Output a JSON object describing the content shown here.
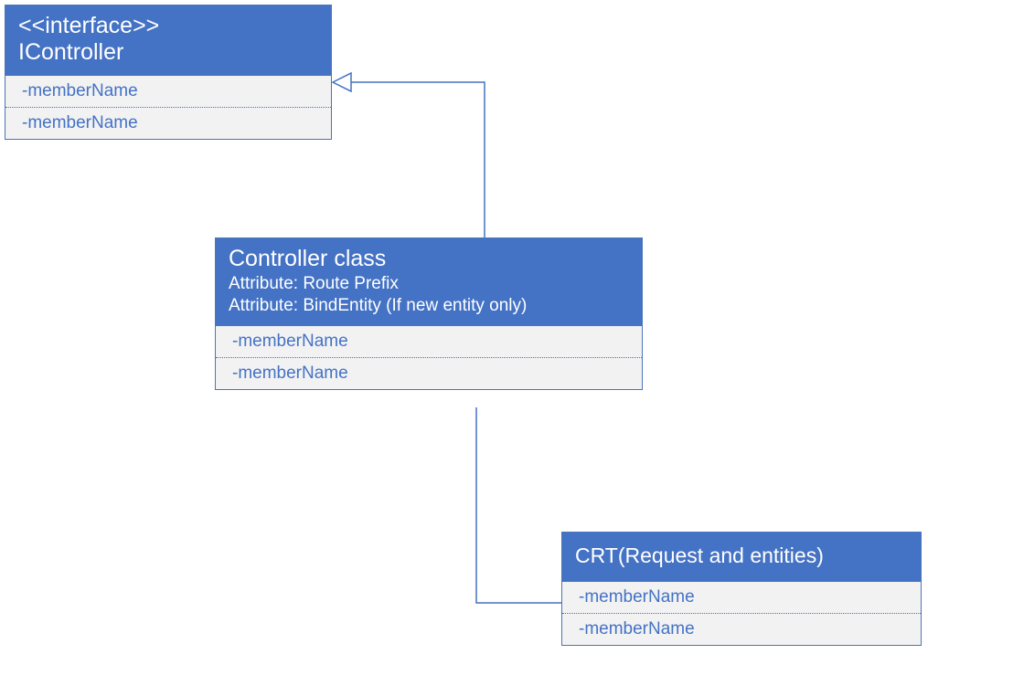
{
  "diagram": {
    "interface": {
      "stereotype": "<<interface>>",
      "name": "IController",
      "members": [
        "-memberName",
        "-memberName"
      ]
    },
    "controller": {
      "name": "Controller class",
      "attributes": [
        "Attribute: Route Prefix",
        "Attribute: BindEntity (If new entity only)"
      ],
      "members": [
        "-memberName",
        "-memberName"
      ]
    },
    "crt": {
      "name": "CRT(Request and entities)",
      "members": [
        "-memberName",
        "-memberName"
      ]
    }
  },
  "colors": {
    "headerFill": "#4472c4",
    "memberBg": "#f2f2f2",
    "memberText": "#4472c4",
    "border": "#4a76b8"
  }
}
